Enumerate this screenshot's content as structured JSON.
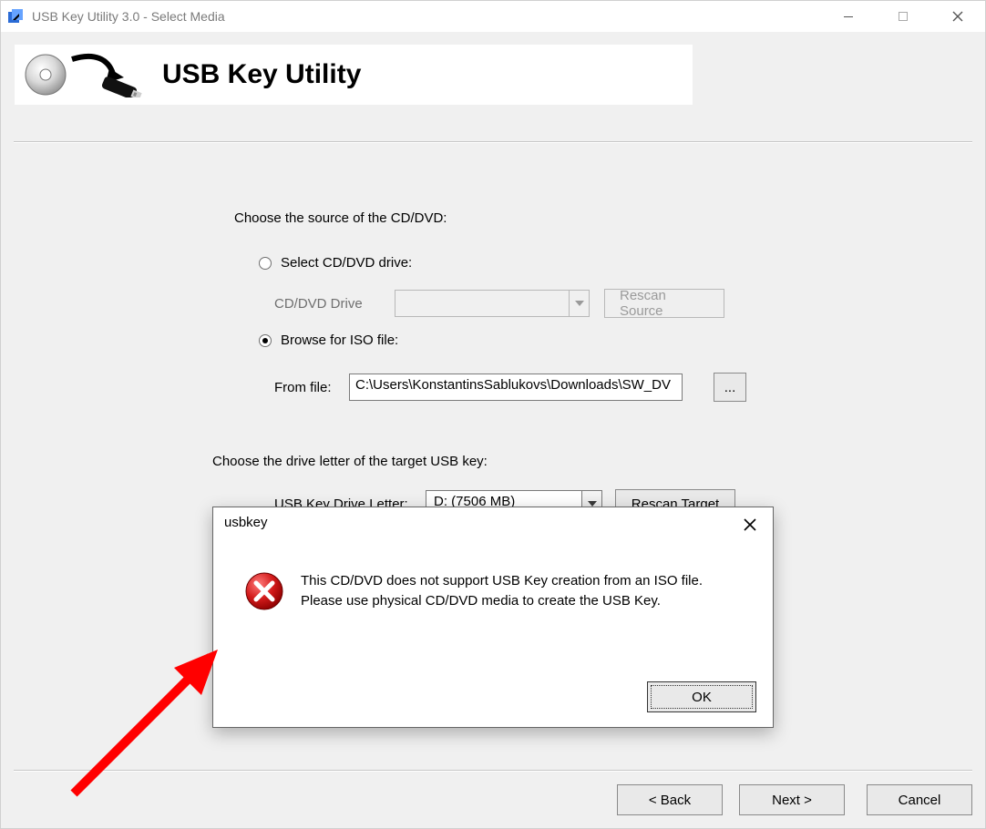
{
  "window": {
    "title": "USB Key Utility 3.0 - Select Media"
  },
  "banner": {
    "title": "USB Key Utility"
  },
  "source": {
    "heading": "Choose the source of the CD/DVD:",
    "radio_drive_label": "Select CD/DVD drive:",
    "radio_iso_label": "Browse for ISO file:",
    "drive_label": "CD/DVD Drive",
    "drive_value": "",
    "rescan_source_label": "Rescan Source",
    "fromfile_label": "From file:",
    "fromfile_value": "C:\\Users\\KonstantinsSablukovs\\Downloads\\SW_DV",
    "browse_label": "...",
    "selected_radio": "iso"
  },
  "target": {
    "heading": "Choose the drive letter of the target USB key:",
    "label": "USB Key Drive Letter:",
    "value": "D: (7506 MB)",
    "rescan_target_label": "Rescan Target"
  },
  "footer": {
    "back_label": "< Back",
    "next_label": "Next >",
    "cancel_label": "Cancel"
  },
  "dialog": {
    "title": "usbkey",
    "message": "This CD/DVD does not support USB Key creation from an ISO file.  Please use physical CD/DVD media to create the USB Key.",
    "ok_label": "OK"
  },
  "colors": {
    "arrow": "#ff0000"
  }
}
